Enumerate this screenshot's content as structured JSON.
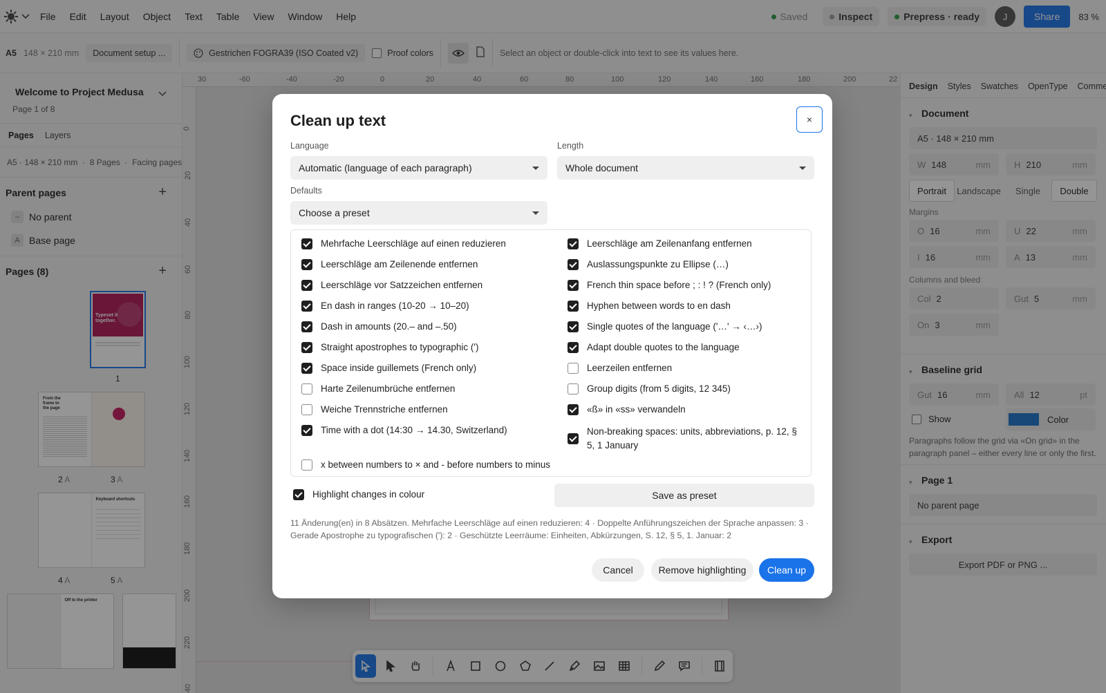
{
  "menubar": {
    "items": [
      "File",
      "Edit",
      "Layout",
      "Object",
      "Text",
      "Table",
      "View",
      "Window",
      "Help"
    ],
    "saved": "Saved",
    "inspect": "Inspect",
    "prepress": "Prepress · ready",
    "avatar": "J",
    "share": "Share",
    "zoom": "83 %"
  },
  "toolbar": {
    "format": "A5",
    "size": "148 × 210 mm",
    "doc_setup": "Document setup ...",
    "color_profile": "Gestrichen FOGRA39 (ISO Coated v2)",
    "proof_colors": "Proof colors",
    "hint": "Select an object or double-click into text to see its values here."
  },
  "left": {
    "project_title": "Welcome to Project Medusa",
    "page_of": "Page 1 of 8",
    "tabs": [
      "Pages",
      "Layers"
    ],
    "doc_info": "A5 · 148 × 210 mm  ·  8 Pages  ·  Facing pages",
    "parent_pages_title": "Parent pages",
    "parents": [
      {
        "badge": "–",
        "label": "No parent"
      },
      {
        "badge": "A",
        "label": "Base page"
      }
    ],
    "pages_title": "Pages (8)",
    "page_labels": [
      "1",
      "2",
      "A",
      "3",
      "A",
      "4",
      "A",
      "5",
      "A"
    ],
    "thumb_text": {
      "p1": "Typeset it together.",
      "p2": "From the frame to the page",
      "p5": "Keyboard shortcuts",
      "p6": "Off to the printer"
    }
  },
  "ruler": {
    "top": [
      "30",
      "-60",
      "-40",
      "-20",
      "0",
      "20",
      "40",
      "60",
      "80",
      "100",
      "120",
      "140",
      "160",
      "180",
      "200",
      "22"
    ],
    "left": [
      "0",
      "20",
      "40",
      "60",
      "80",
      "100",
      "120",
      "140",
      "160",
      "180",
      "200",
      "220",
      "40"
    ]
  },
  "right": {
    "tabs": [
      "Design",
      "Styles",
      "Swatches",
      "OpenType",
      "Comments"
    ],
    "document_title": "Document",
    "doc_size": "A5 · 148 × 210 mm",
    "w_label": "W",
    "w_value": "148",
    "h_label": "H",
    "h_value": "210",
    "unit_mm": "mm",
    "orientation": [
      "Portrait",
      "Landscape"
    ],
    "sides": [
      "Single",
      "Double"
    ],
    "margins_label": "Margins",
    "margins": [
      {
        "lab": "O",
        "val": "16"
      },
      {
        "lab": "U",
        "val": "22"
      },
      {
        "lab": "I",
        "val": "16"
      },
      {
        "lab": "A",
        "val": "13"
      }
    ],
    "columns_label": "Columns and bleed",
    "col_lab": "Col",
    "col_val": "2",
    "gut_lab": "Gut",
    "gut_val": "5",
    "on_lab": "On",
    "on_val": "3",
    "baseline_title": "Baseline grid",
    "bgut_lab": "Gut",
    "bgut_val": "16",
    "all_lab": "All",
    "all_val": "12",
    "unit_pt": "pt",
    "show_label": "Show",
    "color_label": "Color",
    "grid_color": "#1a73c8",
    "baseline_hint": "Paragraphs follow the grid via «On grid» in the paragraph panel – either every line or only the first.",
    "page1_title": "Page 1",
    "no_parent_page": "No parent page",
    "export_title": "Export",
    "export_button": "Export PDF or PNG ..."
  },
  "dialog": {
    "title": "Clean up text",
    "close": "×",
    "language_label": "Language",
    "language_value": "Automatic (language of each paragraph)",
    "length_label": "Length",
    "length_value": "Whole document",
    "defaults_label": "Defaults",
    "defaults_value": "Choose a preset",
    "options_left": [
      {
        "label": "Mehrfache Leerschläge auf einen reduzieren",
        "checked": true
      },
      {
        "label": "Leerschläge am Zeilenende entfernen",
        "checked": true
      },
      {
        "label": "Leerschläge vor Satzzeichen entfernen",
        "checked": true
      },
      {
        "label": "En dash in ranges (10-20 → 10–20)",
        "checked": true
      },
      {
        "label": "Dash in amounts (20.– and –.50)",
        "checked": true
      },
      {
        "label": "Straight apostrophes to typographic (')",
        "checked": true
      },
      {
        "label": "Space inside guillemets (French only)",
        "checked": true
      },
      {
        "label": "Harte Zeilenumbrüche entfernen",
        "checked": false
      },
      {
        "label": "Weiche Trennstriche entfernen",
        "checked": false
      },
      {
        "label": "Time with a dot (14:30 → 14.30, Switzerland)",
        "checked": true
      },
      {
        "label": "x between numbers to × and - before numbers to minus",
        "checked": false
      }
    ],
    "options_right": [
      {
        "label": "Leerschläge am Zeilenanfang entfernen",
        "checked": true
      },
      {
        "label": "Auslassungspunkte zu Ellipse (…)",
        "checked": true
      },
      {
        "label": "French thin space before ; : ! ? (French only)",
        "checked": true
      },
      {
        "label": "Hyphen between words to en dash",
        "checked": true
      },
      {
        "label": "Single quotes of the language ('…' → ‹…›)",
        "checked": true
      },
      {
        "label": "Adapt double quotes to the language",
        "checked": true
      },
      {
        "label": "Leerzeilen entfernen",
        "checked": false
      },
      {
        "label": "Group digits (from 5 digits, 12 345)",
        "checked": false
      },
      {
        "label": "«ß» in «ss» verwandeln",
        "checked": true
      },
      {
        "label": "Non-breaking spaces: units, abbreviations, p. 12, § 5, 1 January",
        "checked": true
      }
    ],
    "highlight_label": "Highlight changes in colour",
    "highlight_checked": true,
    "save_preset": "Save as preset",
    "summary": "11 Änderung(en) in 8 Absätzen. Mehrfache Leerschläge auf einen reduzieren: 4 · Doppelte Anführungszeichen der Sprache anpassen: 3 · Gerade Apostrophe zu typografischen ('): 2 · Geschützte Leerräume: Einheiten, Abkürzungen, S. 12, § 5, 1. Januar: 2",
    "cancel": "Cancel",
    "remove_highlighting": "Remove highlighting",
    "clean_up": "Clean up"
  }
}
